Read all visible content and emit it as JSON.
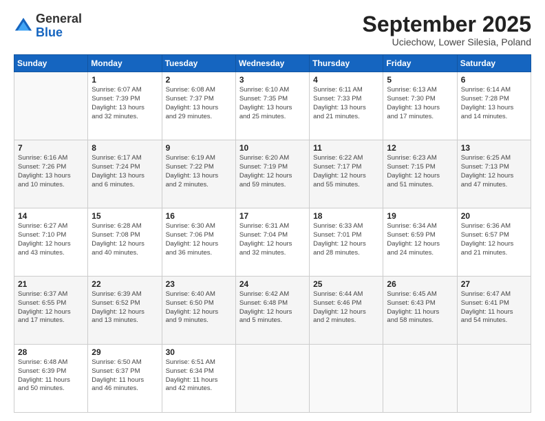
{
  "header": {
    "logo_general": "General",
    "logo_blue": "Blue",
    "month_title": "September 2025",
    "location": "Uciechow, Lower Silesia, Poland"
  },
  "days_of_week": [
    "Sunday",
    "Monday",
    "Tuesday",
    "Wednesday",
    "Thursday",
    "Friday",
    "Saturday"
  ],
  "weeks": [
    [
      {
        "day": "",
        "info": ""
      },
      {
        "day": "1",
        "info": "Sunrise: 6:07 AM\nSunset: 7:39 PM\nDaylight: 13 hours\nand 32 minutes."
      },
      {
        "day": "2",
        "info": "Sunrise: 6:08 AM\nSunset: 7:37 PM\nDaylight: 13 hours\nand 29 minutes."
      },
      {
        "day": "3",
        "info": "Sunrise: 6:10 AM\nSunset: 7:35 PM\nDaylight: 13 hours\nand 25 minutes."
      },
      {
        "day": "4",
        "info": "Sunrise: 6:11 AM\nSunset: 7:33 PM\nDaylight: 13 hours\nand 21 minutes."
      },
      {
        "day": "5",
        "info": "Sunrise: 6:13 AM\nSunset: 7:30 PM\nDaylight: 13 hours\nand 17 minutes."
      },
      {
        "day": "6",
        "info": "Sunrise: 6:14 AM\nSunset: 7:28 PM\nDaylight: 13 hours\nand 14 minutes."
      }
    ],
    [
      {
        "day": "7",
        "info": "Sunrise: 6:16 AM\nSunset: 7:26 PM\nDaylight: 13 hours\nand 10 minutes."
      },
      {
        "day": "8",
        "info": "Sunrise: 6:17 AM\nSunset: 7:24 PM\nDaylight: 13 hours\nand 6 minutes."
      },
      {
        "day": "9",
        "info": "Sunrise: 6:19 AM\nSunset: 7:22 PM\nDaylight: 13 hours\nand 2 minutes."
      },
      {
        "day": "10",
        "info": "Sunrise: 6:20 AM\nSunset: 7:19 PM\nDaylight: 12 hours\nand 59 minutes."
      },
      {
        "day": "11",
        "info": "Sunrise: 6:22 AM\nSunset: 7:17 PM\nDaylight: 12 hours\nand 55 minutes."
      },
      {
        "day": "12",
        "info": "Sunrise: 6:23 AM\nSunset: 7:15 PM\nDaylight: 12 hours\nand 51 minutes."
      },
      {
        "day": "13",
        "info": "Sunrise: 6:25 AM\nSunset: 7:13 PM\nDaylight: 12 hours\nand 47 minutes."
      }
    ],
    [
      {
        "day": "14",
        "info": "Sunrise: 6:27 AM\nSunset: 7:10 PM\nDaylight: 12 hours\nand 43 minutes."
      },
      {
        "day": "15",
        "info": "Sunrise: 6:28 AM\nSunset: 7:08 PM\nDaylight: 12 hours\nand 40 minutes."
      },
      {
        "day": "16",
        "info": "Sunrise: 6:30 AM\nSunset: 7:06 PM\nDaylight: 12 hours\nand 36 minutes."
      },
      {
        "day": "17",
        "info": "Sunrise: 6:31 AM\nSunset: 7:04 PM\nDaylight: 12 hours\nand 32 minutes."
      },
      {
        "day": "18",
        "info": "Sunrise: 6:33 AM\nSunset: 7:01 PM\nDaylight: 12 hours\nand 28 minutes."
      },
      {
        "day": "19",
        "info": "Sunrise: 6:34 AM\nSunset: 6:59 PM\nDaylight: 12 hours\nand 24 minutes."
      },
      {
        "day": "20",
        "info": "Sunrise: 6:36 AM\nSunset: 6:57 PM\nDaylight: 12 hours\nand 21 minutes."
      }
    ],
    [
      {
        "day": "21",
        "info": "Sunrise: 6:37 AM\nSunset: 6:55 PM\nDaylight: 12 hours\nand 17 minutes."
      },
      {
        "day": "22",
        "info": "Sunrise: 6:39 AM\nSunset: 6:52 PM\nDaylight: 12 hours\nand 13 minutes."
      },
      {
        "day": "23",
        "info": "Sunrise: 6:40 AM\nSunset: 6:50 PM\nDaylight: 12 hours\nand 9 minutes."
      },
      {
        "day": "24",
        "info": "Sunrise: 6:42 AM\nSunset: 6:48 PM\nDaylight: 12 hours\nand 5 minutes."
      },
      {
        "day": "25",
        "info": "Sunrise: 6:44 AM\nSunset: 6:46 PM\nDaylight: 12 hours\nand 2 minutes."
      },
      {
        "day": "26",
        "info": "Sunrise: 6:45 AM\nSunset: 6:43 PM\nDaylight: 11 hours\nand 58 minutes."
      },
      {
        "day": "27",
        "info": "Sunrise: 6:47 AM\nSunset: 6:41 PM\nDaylight: 11 hours\nand 54 minutes."
      }
    ],
    [
      {
        "day": "28",
        "info": "Sunrise: 6:48 AM\nSunset: 6:39 PM\nDaylight: 11 hours\nand 50 minutes."
      },
      {
        "day": "29",
        "info": "Sunrise: 6:50 AM\nSunset: 6:37 PM\nDaylight: 11 hours\nand 46 minutes."
      },
      {
        "day": "30",
        "info": "Sunrise: 6:51 AM\nSunset: 6:34 PM\nDaylight: 11 hours\nand 42 minutes."
      },
      {
        "day": "",
        "info": ""
      },
      {
        "day": "",
        "info": ""
      },
      {
        "day": "",
        "info": ""
      },
      {
        "day": "",
        "info": ""
      }
    ]
  ]
}
